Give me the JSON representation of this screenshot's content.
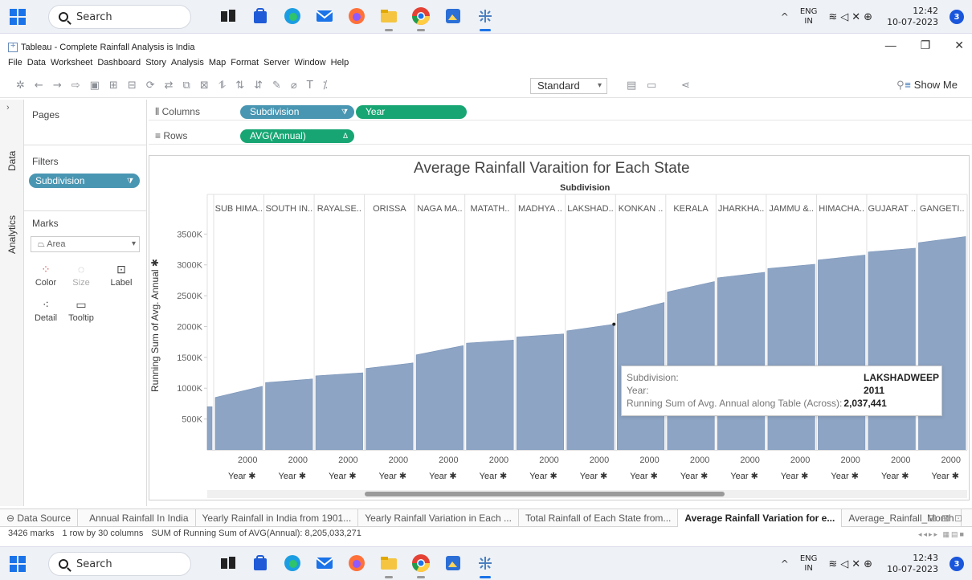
{
  "taskbar_top": {
    "search": "Search",
    "lang": "ENG",
    "region": "IN",
    "time": "12:42",
    "date": "10-07-2023",
    "notif": "3"
  },
  "taskbar_bottom": {
    "search": "Search",
    "lang": "ENG",
    "region": "IN",
    "time": "12:43",
    "date": "10-07-2023",
    "notif": "3"
  },
  "window": {
    "title": "Tableau - Complete Rainfall Analysis is India"
  },
  "menu": [
    "File",
    "Data",
    "Worksheet",
    "Dashboard",
    "Story",
    "Analysis",
    "Map",
    "Format",
    "Server",
    "Window",
    "Help"
  ],
  "toolbar": {
    "fit": "Standard",
    "show_me": "Show Me"
  },
  "side_tabs": {
    "data": "Data",
    "analytics": "Analytics"
  },
  "pages": {
    "title": "Pages"
  },
  "filters": {
    "title": "Filters",
    "pill": "Subdivision"
  },
  "marks": {
    "title": "Marks",
    "type": "Area",
    "buttons": [
      {
        "label": "Color",
        "icon": "color-icon"
      },
      {
        "label": "Size",
        "icon": "size-icon"
      },
      {
        "label": "Label",
        "icon": "label-icon"
      },
      {
        "label": "Detail",
        "icon": "detail-icon"
      },
      {
        "label": "Tooltip",
        "icon": "tooltip-icon"
      }
    ]
  },
  "shelves": {
    "columns_label": "Columns",
    "rows_label": "Rows",
    "columns": [
      "Subdivision",
      "Year"
    ],
    "rows": [
      "AVG(Annual)"
    ]
  },
  "chart_data": {
    "type": "area",
    "title": "Average Rainfall Varaition for Each State",
    "header_title": "Subdivision",
    "ylabel": "Running Sum of Avg. Annual",
    "ylim": [
      0,
      3700000
    ],
    "y_ticks": [
      "3500K",
      "3000K",
      "2500K",
      "2000K",
      "1500K",
      "1000K",
      "500K"
    ],
    "x_tick": "2000",
    "x_label": "Year",
    "panels": [
      {
        "name": "",
        "start": 700000,
        "end": 700000
      },
      {
        "name": "SUB HIMA..",
        "start": 850000,
        "end": 1030000
      },
      {
        "name": "SOUTH IN..",
        "start": 1090000,
        "end": 1150000
      },
      {
        "name": "RAYALSE..",
        "start": 1200000,
        "end": 1250000
      },
      {
        "name": "ORISSA",
        "start": 1320000,
        "end": 1410000
      },
      {
        "name": "NAGA MA..",
        "start": 1540000,
        "end": 1690000
      },
      {
        "name": "MATATH..",
        "start": 1730000,
        "end": 1780000
      },
      {
        "name": "MADHYA ..",
        "start": 1830000,
        "end": 1880000
      },
      {
        "name": "LAKSHAD..",
        "start": 1930000,
        "end": 2037441
      },
      {
        "name": "KONKAN ..",
        "start": 2200000,
        "end": 2390000
      },
      {
        "name": "KERALA",
        "start": 2560000,
        "end": 2730000
      },
      {
        "name": "JHARKHA..",
        "start": 2790000,
        "end": 2880000
      },
      {
        "name": "JAMMU &..",
        "start": 2940000,
        "end": 3010000
      },
      {
        "name": "HIMACHA..",
        "start": 3080000,
        "end": 3160000
      },
      {
        "name": "GUJARAT ..",
        "start": 3210000,
        "end": 3270000
      },
      {
        "name": "GANGETI..",
        "start": 3360000,
        "end": 3460000
      }
    ],
    "color": "#8da4c4"
  },
  "tooltip": {
    "subdivision_label": "Subdivision:",
    "subdivision_value": "LAKSHADWEEP",
    "year_label": "Year:",
    "year_value": "2011",
    "measure_label": "Running Sum of Avg. Annual along Table (Across):",
    "measure_value": "2,037,441"
  },
  "sheets": [
    "Data Source",
    "Annual Rainfall In India",
    "Yearly Rainfall in India from 1901...",
    "Yearly Rainfall Variation in Each ...",
    "Total Rainfall of Each State from...",
    "Average Rainfall Variation for e...",
    "Average_Rainfall_Month"
  ],
  "status": {
    "marks": "3426 marks",
    "dims": "1 row by 30 columns",
    "sum": "SUM of Running Sum of AVG(Annual): 8,205,033,271"
  }
}
